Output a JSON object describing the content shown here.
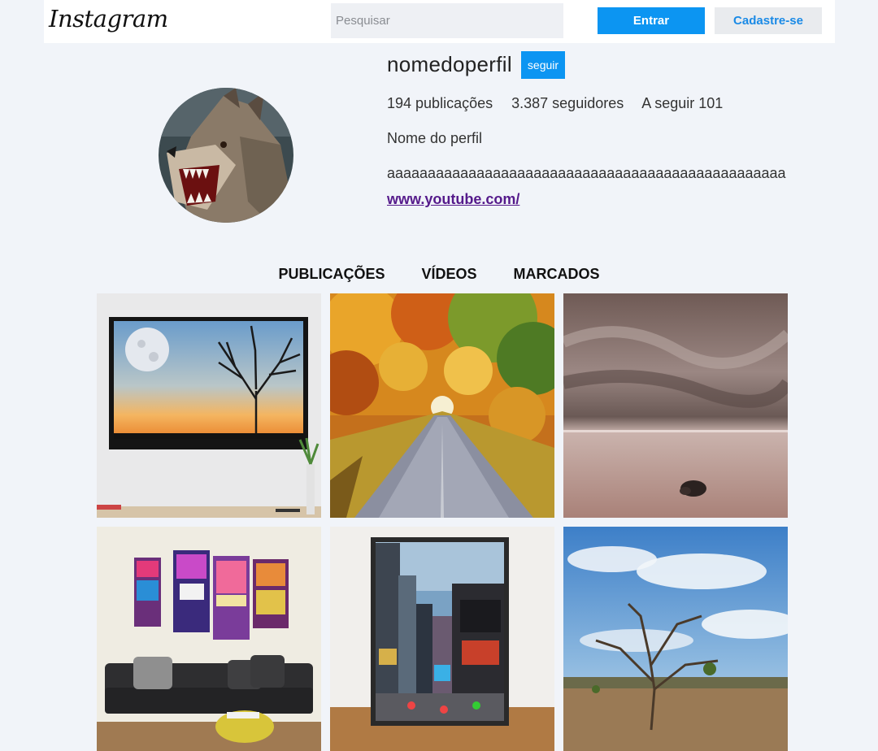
{
  "header": {
    "logo": "Instagram",
    "search_placeholder": "Pesquisar",
    "login_label": "Entrar",
    "signup_label": "Cadastre-se"
  },
  "profile": {
    "username": "nomedoperfil",
    "follow_label": "seguir",
    "stats": {
      "posts": "194 publicações",
      "followers": "3.387 seguidores",
      "following": "A seguir 101"
    },
    "full_name": "Nome do perfil",
    "bio": "aaaaaaaaaaaaaaaaaaaaaaaaaaaaaaaaaaaaaaaaaaaaaaaaa",
    "link": "www.youtube.com/"
  },
  "tabs": [
    "PUBLICAÇÕES",
    "VÍDEOS",
    "MARCADOS"
  ],
  "colors": {
    "accent": "#0c95f2",
    "background": "#f1f4f9",
    "link": "#551a8b"
  },
  "posts": [
    {
      "subject": "framed sunset tree and moon painting"
    },
    {
      "subject": "autumn tree tunnel road"
    },
    {
      "subject": "cloudy sea with rock"
    },
    {
      "subject": "times square canvas over sofa"
    },
    {
      "subject": "framed city street poster"
    },
    {
      "subject": "dry tree under blue sky"
    }
  ]
}
